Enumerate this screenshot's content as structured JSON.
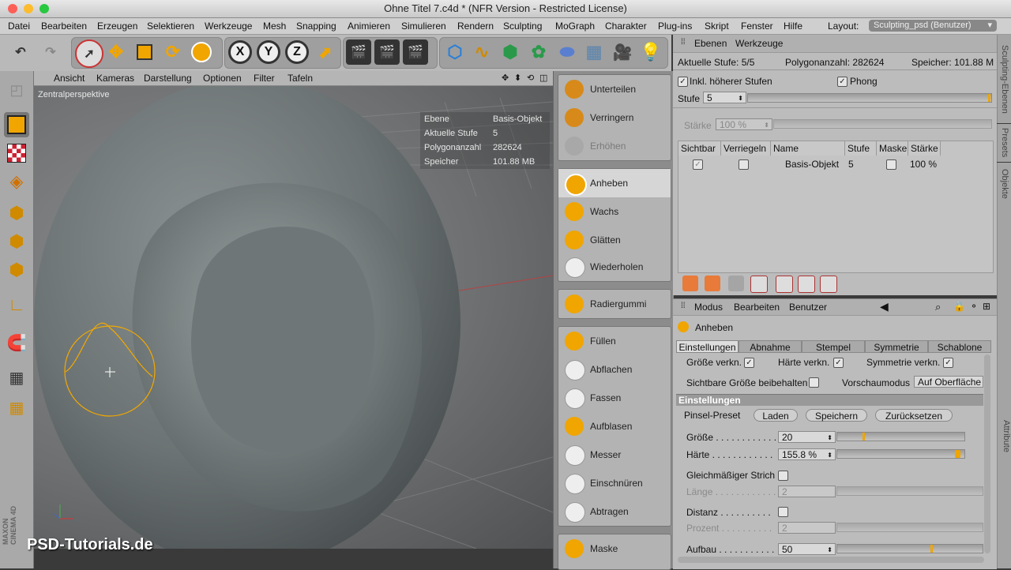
{
  "window": {
    "title": "Ohne Titel 7.c4d * (NFR Version - Restricted License)"
  },
  "menu": [
    "Datei",
    "Bearbeiten",
    "Erzeugen",
    "Selektieren",
    "Werkzeuge",
    "Mesh",
    "Snapping",
    "Animieren",
    "Simulieren",
    "Rendern",
    "Sculpting",
    "MoGraph",
    "Charakter",
    "Plug-ins",
    "Skript",
    "Fenster",
    "Hilfe"
  ],
  "layout": {
    "label": "Layout:",
    "value": "Sculpting_psd (Benutzer)"
  },
  "toolbar": {
    "x": "X",
    "y": "Y",
    "z": "Z"
  },
  "viewport": {
    "menus": [
      "Ansicht",
      "Kameras",
      "Darstellung",
      "Optionen",
      "Filter",
      "Tafeln"
    ],
    "camera": "Zentralperspektive",
    "hud": [
      {
        "k": "Ebene",
        "v": "Basis-Objekt"
      },
      {
        "k": "Aktuelle Stufe",
        "v": "5"
      },
      {
        "k": "Polygonanzahl",
        "v": "282624"
      },
      {
        "k": "Speicher",
        "v": "101.88 MB"
      }
    ],
    "watermark": "PSD-Tutorials.de",
    "maxon": "MAXON CINEMA 4D"
  },
  "brushes": [
    {
      "label": "Unterteilen",
      "disabled": false
    },
    {
      "label": "Verringern",
      "disabled": false
    },
    {
      "label": "Erhöhen",
      "disabled": true
    },
    {
      "label": "Anheben",
      "disabled": false,
      "selected": true
    },
    {
      "label": "Wachs",
      "disabled": false
    },
    {
      "label": "Glätten",
      "disabled": false
    },
    {
      "label": "Wiederholen",
      "disabled": false
    },
    {
      "label": "Radiergummi",
      "disabled": false
    },
    {
      "label": "Füllen",
      "disabled": false
    },
    {
      "label": "Abflachen",
      "disabled": false
    },
    {
      "label": "Fassen",
      "disabled": false
    },
    {
      "label": "Aufblasen",
      "disabled": false
    },
    {
      "label": "Messer",
      "disabled": false
    },
    {
      "label": "Einschnüren",
      "disabled": false
    },
    {
      "label": "Abtragen",
      "disabled": false
    },
    {
      "label": "Maske",
      "disabled": false
    }
  ],
  "layers": {
    "tabs": [
      "Ebenen",
      "Werkzeuge"
    ],
    "current_level": "Aktuelle Stufe: 5/5",
    "polycount": "Polygonanzahl: 282624",
    "memory": "Speicher: 101.88 M",
    "incl_higher": "Inkl. höherer Stufen",
    "phong": "Phong",
    "stufe_label": "Stufe",
    "stufe_value": "5",
    "staerke_label": "Stärke",
    "staerke_value": "100 %",
    "columns": [
      "Sichtbar",
      "Verriegeln",
      "Name",
      "Stufe",
      "Maske",
      "Stärke"
    ],
    "row": {
      "name": "Basis-Objekt",
      "stufe": "5",
      "staerke": "100 %"
    }
  },
  "side_tabs": [
    "Sculpting-Ebenen",
    "Presets",
    "Objekte",
    "Attribute"
  ],
  "attr": {
    "menus": [
      "Modus",
      "Bearbeiten",
      "Benutzer"
    ],
    "tool": "Anheben",
    "tabs": [
      "Einstellungen",
      "Abnahme",
      "Stempel",
      "Symmetrie",
      "Schablone"
    ],
    "groesse_verkn": "Größe verkn.",
    "haerte_verkn": "Härte verkn.",
    "symmetrie_verkn": "Symmetrie verkn.",
    "sichtbare": "Sichtbare Größe beibehalten",
    "vorschau_label": "Vorschaumodus",
    "vorschau_value": "Auf Oberfläche",
    "section": "Einstellungen",
    "preset_label": "Pinsel-Preset",
    "btn_laden": "Laden",
    "btn_speichern": "Speichern",
    "btn_zurueck": "Zurücksetzen",
    "groesse_label": "Größe . . . . . . . . . . . .",
    "groesse_value": "20",
    "groesse_level": 0.2,
    "haerte_label": "Härte . . . . . . . . . . . .",
    "haerte_value": "155.8 %",
    "haerte_level": 0.97,
    "gleich": "Gleichmäßiger Strich",
    "laenge_label": "Länge . . . . . . . . . . . .",
    "laenge_value": "2",
    "distanz": "Distanz . . . . . . . . . .",
    "prozent_label": "Prozent . . . . . . . . . .",
    "prozent_value": "2",
    "aufbau_label": "Aufbau . . . . . . . . . . .",
    "aufbau_value": "50",
    "aufbau_level": 0.65
  },
  "colors": {
    "accent": "#f0a500",
    "brush_ring": "#f2a900"
  }
}
